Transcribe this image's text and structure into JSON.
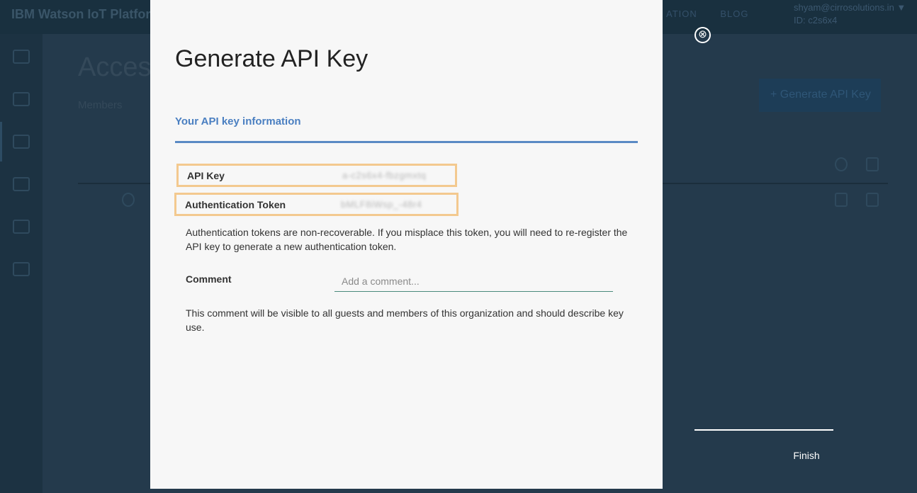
{
  "background": {
    "brand": "IBM Watson IoT Platform",
    "nav": [
      "ATION",
      "BLOG"
    ],
    "user_email": "shyam@cirrosolutions.in ▼",
    "user_org": "ID: c2s6x4",
    "page_title": "Acces",
    "tabs": [
      "Members",
      "|"
    ],
    "generate_button": "+ Generate API Key"
  },
  "modal": {
    "title": "Generate API Key",
    "section_label": "Your API key information",
    "api_key_label": "API Key",
    "api_key_value": "a-c2s6x4-fbzgmxtq",
    "auth_token_label": "Authentication Token",
    "auth_token_value": "bMLF8iWsp_-48r4",
    "token_note": "Authentication tokens are non-recoverable. If you misplace this token, you will need to re-register the API key to generate a new authentication token.",
    "comment_label": "Comment",
    "comment_placeholder": "Add a comment...",
    "comment_note": "This comment will be visible to all guests and members of this organization and should describe key use."
  },
  "controls": {
    "close_icon": "⊗",
    "finish_label": "Finish"
  },
  "colors": {
    "accent_blue": "#4a7fc1",
    "highlight_box": "#f3c98f",
    "input_underline": "#4a8a7c"
  }
}
